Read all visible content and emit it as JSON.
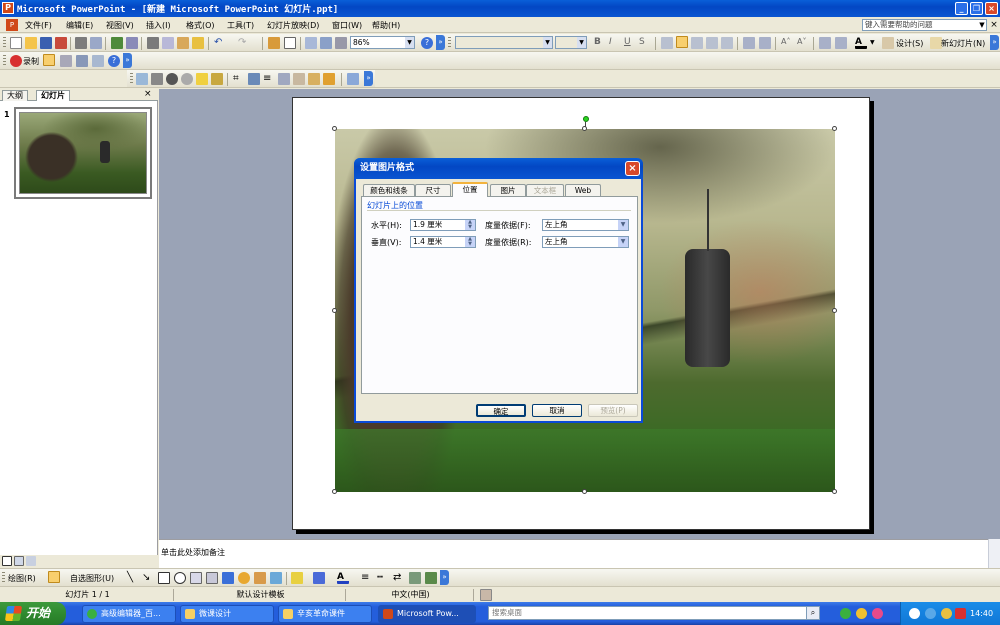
{
  "window": {
    "title": "Microsoft PowerPoint - [新建 Microsoft PowerPoint 幻灯片.ppt]"
  },
  "menu": {
    "items": [
      "文件(F)",
      "编辑(E)",
      "视图(V)",
      "插入(I)",
      "格式(O)",
      "工具(T)",
      "幻灯片放映(D)",
      "窗口(W)",
      "帮助(H)"
    ],
    "help_placeholder": "键入需要帮助的问题"
  },
  "toolbar": {
    "zoom": "86%",
    "font_name": "",
    "font_size": "",
    "design_label": "设计(S)",
    "new_slide_label": "新幻灯片(N)",
    "record_label": "录制"
  },
  "left_pane": {
    "tab_outline": "大纲",
    "tab_slides": "幻灯片",
    "close": "×",
    "slide_number": "1"
  },
  "notes": {
    "placeholder": "单击此处添加备注"
  },
  "drawing_toolbar": {
    "draw_label": "绘图(R)",
    "autoshapes_label": "自选图形(U)"
  },
  "status": {
    "slide_position": "幻灯片 1 / 1",
    "template": "默认设计模板",
    "language": "中文(中国)"
  },
  "dialog": {
    "title": "设置图片格式",
    "tabs": [
      "颜色和线条",
      "尺寸",
      "位置",
      "图片",
      "文本框",
      "Web"
    ],
    "active_tab": 2,
    "group_label": "幻灯片上的位置",
    "horizontal_label": "水平(H):",
    "horizontal_value": "1.9 厘米",
    "vertical_label": "垂直(V):",
    "vertical_value": "1.4 厘米",
    "from_label_h": "度量依据(F):",
    "from_value_h": "左上角",
    "from_label_v": "度量依据(R):",
    "from_value_v": "左上角",
    "ok": "确定",
    "cancel": "取消",
    "preview": "预览(P)"
  },
  "taskbar": {
    "start": "开始",
    "buttons": [
      "高级编辑器_百...",
      "微课设计",
      "辛亥革命课件",
      "Microsoft Pow..."
    ],
    "search_placeholder": "搜索桌面",
    "clock": "14:40"
  },
  "colors": {
    "title_blue": "#0a5fd8",
    "taskbar_blue": "#245edc",
    "start_green": "#2f8a2f",
    "workspace": "#9aa3b6"
  }
}
